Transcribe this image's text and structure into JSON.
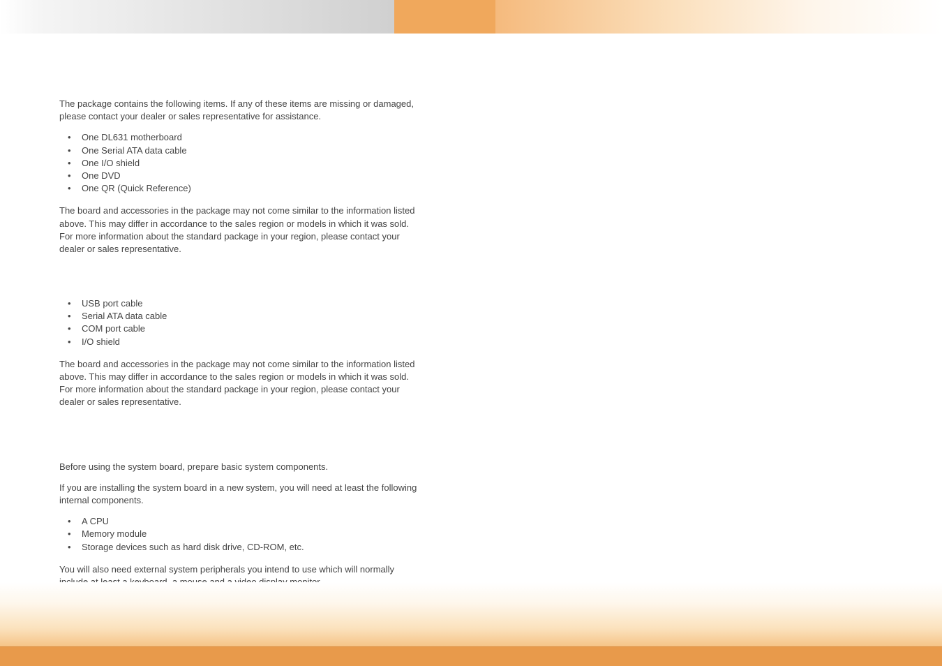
{
  "section1": {
    "intro": "The package contains the following items. If any of these items are missing or damaged, please contact your dealer or sales representative for assistance.",
    "items": [
      "One DL631 motherboard",
      "One Serial ATA data cable",
      "One I/O shield",
      "One DVD",
      "One QR (Quick Reference)"
    ],
    "note": "The board and accessories in the package may not come similar to the information listed above. This may differ in accordance to the sales region or models in which it was sold. For more information about the standard package in your region, please contact your dealer or sales representative."
  },
  "section2": {
    "items": [
      "USB port cable",
      "Serial ATA data cable",
      "COM port cable",
      "I/O shield"
    ],
    "note": "The board and accessories in the package may not come similar to the information listed above. This may differ in accordance to the sales region or models in which it was sold. For more information about the standard package in your region, please contact your dealer or sales representative."
  },
  "section3": {
    "intro1": "Before using the system board, prepare basic system components.",
    "intro2": "If you are installing the system board in a new system, you will need at least the following internal components.",
    "items": [
      "A CPU",
      "Memory module",
      "Storage devices such as hard disk drive, CD-ROM, etc."
    ],
    "outro": "You will also need external system peripherals you intend to use which will normally include at least a keyboard, a mouse and a video display monitor."
  }
}
